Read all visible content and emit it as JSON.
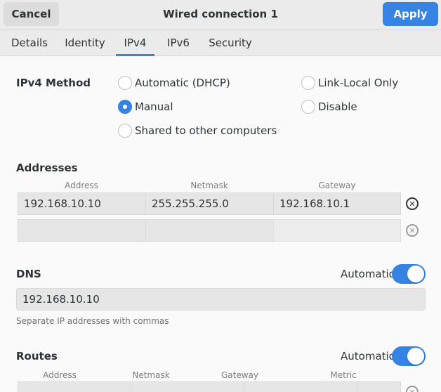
{
  "header": {
    "cancel_label": "Cancel",
    "title": "Wired connection 1",
    "apply_label": "Apply"
  },
  "tabs": [
    {
      "label": "Details"
    },
    {
      "label": "Identity"
    },
    {
      "label": "IPv4",
      "active": true
    },
    {
      "label": "IPv6"
    },
    {
      "label": "Security"
    }
  ],
  "ipv4_method": {
    "label": "IPv4 Method",
    "options": [
      {
        "label": "Automatic (DHCP)",
        "checked": false
      },
      {
        "label": "Manual",
        "checked": true
      },
      {
        "label": "Shared to other computers",
        "checked": false
      },
      {
        "label": "Link-Local Only",
        "checked": false
      },
      {
        "label": "Disable",
        "checked": false
      }
    ]
  },
  "addresses": {
    "label": "Addresses",
    "columns": [
      "Address",
      "Netmask",
      "Gateway"
    ],
    "rows": [
      {
        "address": "192.168.10.10",
        "netmask": "255.255.255.0",
        "gateway": "192.168.10.1"
      },
      {
        "address": "",
        "netmask": "",
        "gateway": ""
      }
    ]
  },
  "dns": {
    "label": "DNS",
    "automatic_label": "Automatic",
    "automatic": true,
    "value": "192.168.10.10",
    "hint": "Separate IP addresses with commas"
  },
  "routes": {
    "label": "Routes",
    "automatic_label": "Automatic",
    "automatic": true,
    "columns": [
      "Address",
      "Netmask",
      "Gateway",
      "Metric"
    ]
  },
  "colors": {
    "accent": "#3584e4",
    "header_bg": "#ebebeb",
    "body_bg": "#fafafa"
  }
}
